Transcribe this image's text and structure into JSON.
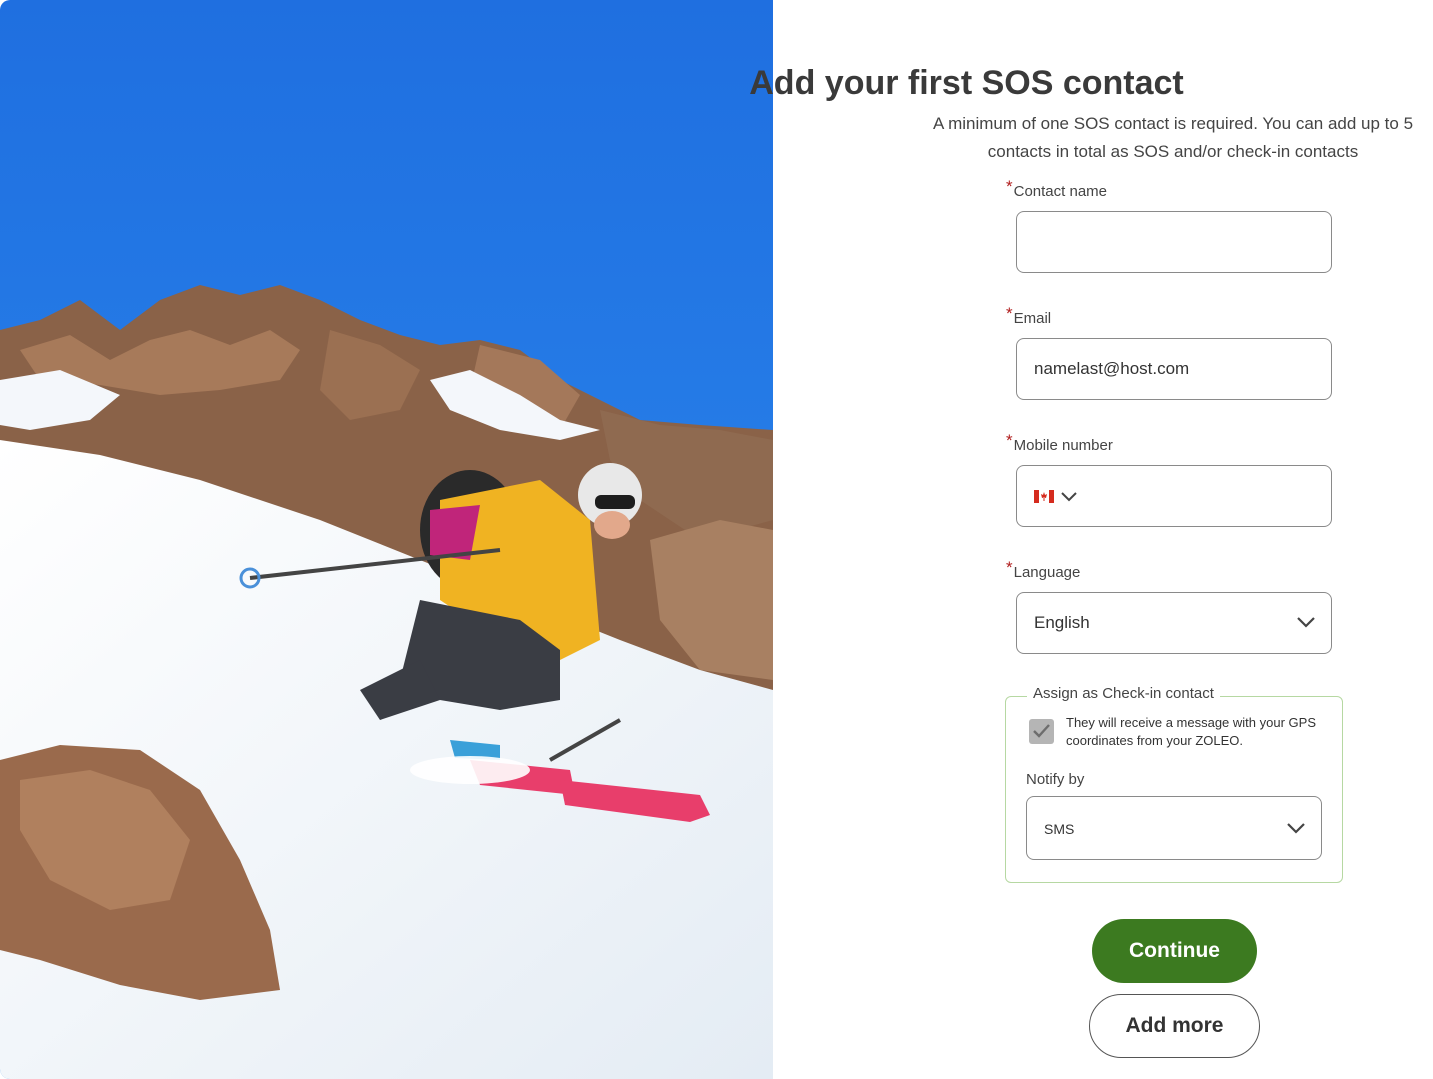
{
  "page": {
    "title": "Add your first SOS contact",
    "subtitle": "A minimum of one SOS contact is required. You can add up to 5 contacts in total as SOS and/or check-in contacts"
  },
  "form": {
    "required_mark": "*",
    "contact_name": {
      "label": "Contact name",
      "value": "",
      "placeholder": ""
    },
    "email": {
      "label": "Email",
      "value": "namelast@host.com"
    },
    "mobile": {
      "label": "Mobile number",
      "country": "CA",
      "flag_icon": "canada-flag-icon",
      "value": ""
    },
    "language": {
      "label": "Language",
      "selected": "English"
    },
    "checkin": {
      "legend": "Assign as Check-in contact",
      "checked": true,
      "description": "They will receive a message with your GPS coordinates from your ZOLEO.",
      "notify_label": "Notify by",
      "notify_selected": "SMS"
    }
  },
  "buttons": {
    "continue": "Continue",
    "add_more": "Add more"
  },
  "colors": {
    "primary": "#3c7a20",
    "required": "#b01c1c",
    "checkin_border": "#b6d8a2",
    "annotation_arrow": "#3d8a22"
  },
  "image": {
    "subject": "skier descending snowy slope",
    "icon": "hero-photo"
  }
}
